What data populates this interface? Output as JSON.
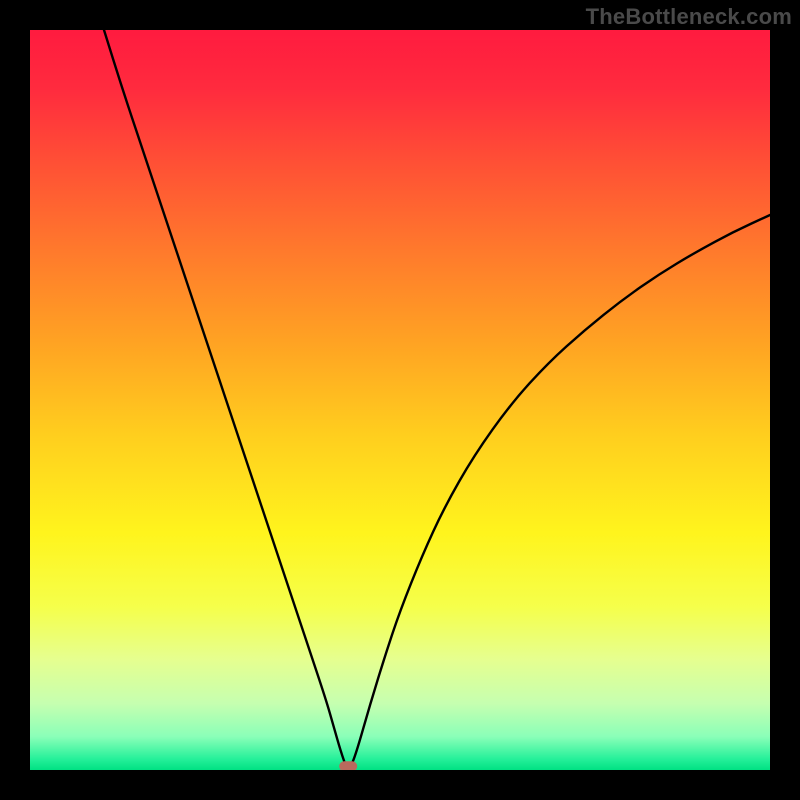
{
  "watermark": "TheBottleneck.com",
  "chart_data": {
    "type": "line",
    "title": "",
    "xlabel": "",
    "ylabel": "",
    "xlim": [
      0,
      100
    ],
    "ylim": [
      0,
      100
    ],
    "grid": false,
    "background_gradient": {
      "stops": [
        {
          "pos": 0.0,
          "color": "#ff1b3f"
        },
        {
          "pos": 0.08,
          "color": "#ff2b3e"
        },
        {
          "pos": 0.18,
          "color": "#ff5035"
        },
        {
          "pos": 0.3,
          "color": "#ff7a2c"
        },
        {
          "pos": 0.42,
          "color": "#ffa223"
        },
        {
          "pos": 0.55,
          "color": "#ffcf1e"
        },
        {
          "pos": 0.68,
          "color": "#fff41d"
        },
        {
          "pos": 0.78,
          "color": "#f5ff4b"
        },
        {
          "pos": 0.85,
          "color": "#e6ff8f"
        },
        {
          "pos": 0.91,
          "color": "#c6ffb0"
        },
        {
          "pos": 0.955,
          "color": "#8affb8"
        },
        {
          "pos": 0.985,
          "color": "#26f09a"
        },
        {
          "pos": 1.0,
          "color": "#00e183"
        }
      ]
    },
    "series": [
      {
        "name": "bottleneck-curve",
        "x": [
          10.0,
          12.5,
          15.0,
          17.5,
          20.0,
          22.5,
          25.0,
          27.5,
          30.0,
          32.5,
          35.0,
          37.5,
          40.0,
          41.0,
          42.0,
          42.8,
          43.2,
          44.0,
          46.0,
          48.0,
          50.0,
          53.0,
          56.0,
          60.0,
          65.0,
          70.0,
          75.0,
          80.0,
          85.0,
          90.0,
          95.0,
          100.0
        ],
        "y": [
          100.0,
          92.0,
          84.5,
          77.0,
          69.5,
          62.0,
          54.5,
          47.0,
          39.5,
          32.0,
          24.5,
          17.0,
          9.5,
          6.0,
          2.5,
          0.2,
          0.2,
          2.0,
          9.0,
          15.5,
          21.5,
          29.0,
          35.5,
          42.5,
          49.5,
          55.0,
          59.5,
          63.5,
          67.0,
          70.0,
          72.7,
          75.0
        ]
      }
    ],
    "marker": {
      "name": "optimal-point",
      "x": 43.0,
      "y": 0.5,
      "color": "#b96a5d",
      "shape": "rounded-pill"
    }
  }
}
